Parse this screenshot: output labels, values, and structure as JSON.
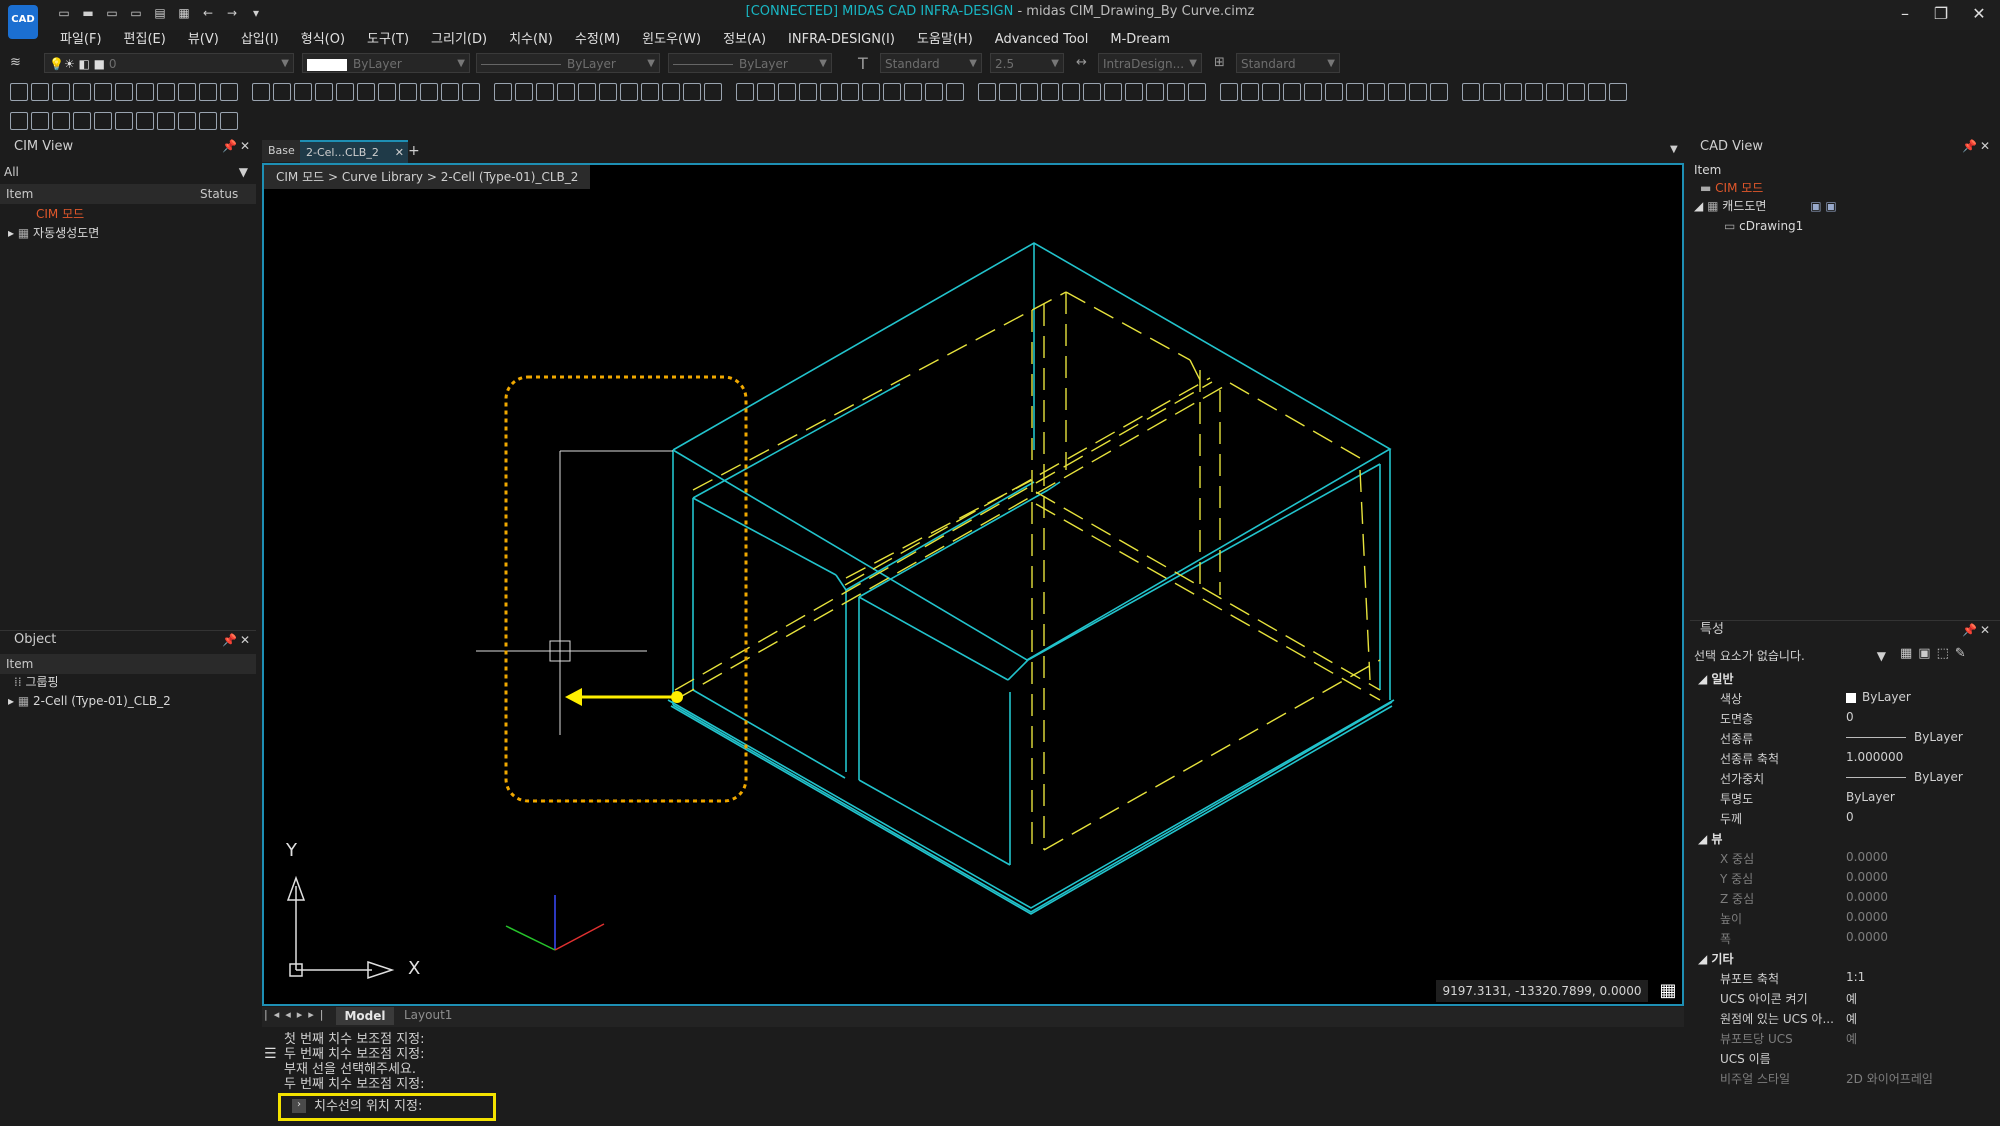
{
  "app": {
    "logo_text": "CAD",
    "title_connected": "[CONNECTED] MIDAS CAD INFRA-DESIGN",
    "title_file": " - midas CIM_Drawing_By Curve.cimz"
  },
  "menu": [
    "파일(F)",
    "편집(E)",
    "뷰(V)",
    "삽입(I)",
    "형식(O)",
    "도구(T)",
    "그리기(D)",
    "치수(N)",
    "수정(M)",
    "윈도우(W)",
    "정보(A)",
    "INFRA-DESIGN(I)",
    "도움말(H)",
    "Advanced Tool",
    "M-Dream"
  ],
  "property_bar": {
    "layer_value": "0",
    "color": "ByLayer",
    "linetype": "ByLayer",
    "lineweight": "ByLayer",
    "text_style": "Standard",
    "text_height": "2.5",
    "dim_style": "IntraDesign...",
    "table_style": "Standard"
  },
  "cim_view": {
    "title": "CIM View",
    "filter": "All",
    "col_item": "Item",
    "col_status": "Status",
    "root": "CIM 모드",
    "child": "자동생성도면"
  },
  "object_panel": {
    "title": "Object",
    "col_item": "Item",
    "group": "그룹핑",
    "child": "2-Cell (Type-01)_CLB_2"
  },
  "tabs": [
    {
      "label": "Base",
      "active": false
    },
    {
      "label": "2-Cel...CLB_2",
      "active": true
    }
  ],
  "breadcrumb": "CIM 모드 > Curve Library > 2-Cell (Type-01)_CLB_2",
  "coordinates": "9197.3131, -13320.7899, 0.0000",
  "ucs": {
    "x": "X",
    "y": "Y"
  },
  "layout_tabs": {
    "model": "Model",
    "layout": "Layout1"
  },
  "command_history": [
    "첫 번째 치수 보조점 지정:",
    "두 번째 치수 보조점 지정:",
    "부재 선을 선택해주세요.",
    "두 번째 치수 보조점 지정:"
  ],
  "command_prompt": "치수선의 위치 지정:",
  "cad_view": {
    "title": "CAD View",
    "col_item": "Item",
    "root": "CIM 모드",
    "node": "캐드도면",
    "leaf": "cDrawing1"
  },
  "properties": {
    "title": "특성",
    "selection": "선택 요소가 없습니다.",
    "sections": [
      {
        "name": "일반",
        "rows": [
          {
            "k": "색상",
            "v": "ByLayer",
            "swatch": true
          },
          {
            "k": "도면층",
            "v": "0"
          },
          {
            "k": "선종류",
            "v": "ByLayer",
            "line": true
          },
          {
            "k": "선종류 축척",
            "v": "1.000000"
          },
          {
            "k": "선가중치",
            "v": "ByLayer",
            "line": true
          },
          {
            "k": "투명도",
            "v": "ByLayer"
          },
          {
            "k": "두께",
            "v": "0"
          }
        ]
      },
      {
        "name": "뷰",
        "rows": [
          {
            "k": "X 중심",
            "v": "0.0000",
            "dim": true
          },
          {
            "k": "Y 중심",
            "v": "0.0000",
            "dim": true
          },
          {
            "k": "Z 중심",
            "v": "0.0000",
            "dim": true
          },
          {
            "k": "높이",
            "v": "0.0000",
            "dim": true
          },
          {
            "k": "폭",
            "v": "0.0000",
            "dim": true
          }
        ]
      },
      {
        "name": "기타",
        "rows": [
          {
            "k": "뷰포트 축척",
            "v": "1:1"
          },
          {
            "k": "UCS 아이콘 켜기",
            "v": "예"
          },
          {
            "k": "원점에 있는 UCS 아...",
            "v": "예"
          },
          {
            "k": "뷰포트당 UCS",
            "v": "예",
            "dim": true
          },
          {
            "k": "UCS 이름",
            "v": ""
          },
          {
            "k": "비주얼 스타일",
            "v": "2D 와이어프레임",
            "dim": true
          }
        ]
      }
    ]
  },
  "colors": {
    "accent": "#1e8fb4",
    "cyan_geometry": "#22c3cc",
    "yellow_geometry": "#e6e23c",
    "highlight": "#f3e200",
    "dotted_box": "#f0a800",
    "orange_text": "#e0572b"
  }
}
